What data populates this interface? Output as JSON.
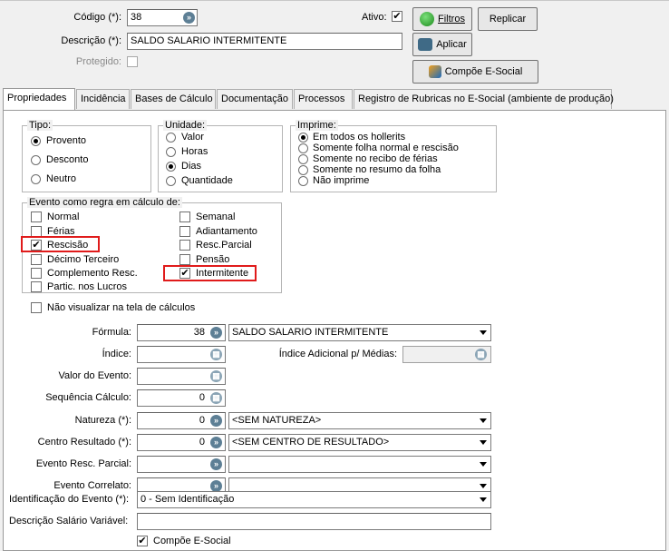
{
  "header": {
    "codigo_label": "Código (*):",
    "codigo_value": "38",
    "descricao_label": "Descrição (*):",
    "descricao_value": "SALDO SALARIO INTERMITENTE",
    "protegido_label": "Protegido:",
    "ativo_label": "Ativo:",
    "ativo_checked": "✔",
    "filtros_label": "Filtros",
    "aplicar_label": "Aplicar",
    "replicar_label": "Replicar",
    "compoe_label": "Compõe E-Social"
  },
  "tabs": [
    {
      "label": "Propriedades"
    },
    {
      "label": "Incidência"
    },
    {
      "label": "Bases de Cálculo"
    },
    {
      "label": "Documentação"
    },
    {
      "label": "Processos"
    },
    {
      "label": "Registro de Rubricas no E-Social (ambiente de produção)"
    }
  ],
  "tipo": {
    "title": "Tipo:",
    "options": [
      "Provento",
      "Desconto",
      "Neutro"
    ],
    "selected": "Provento"
  },
  "unidade": {
    "title": "Unidade:",
    "options": [
      "Valor",
      "Horas",
      "Dias",
      "Quantidade"
    ],
    "selected": "Dias"
  },
  "imprime": {
    "title": "Imprime:",
    "options": [
      "Em todos os hollerits",
      "Somente folha normal e rescisão",
      "Somente no recibo de férias",
      "Somente no resumo da folha",
      "Não imprime"
    ],
    "selected": "Em todos os hollerits"
  },
  "evento": {
    "title": "Evento como regra em cálculo de:",
    "left": [
      "Normal",
      "Férias",
      "Rescisão",
      "Décimo Terceiro",
      "Complemento Resc.",
      "Partic. nos Lucros"
    ],
    "right": [
      "Semanal",
      "Adiantamento",
      "Resc.Parcial",
      "Pensão",
      "Intermitente"
    ],
    "checked_mark": "✔"
  },
  "nao_visualizar_label": "Não visualizar na tela de cálculos",
  "form": {
    "formula_label": "Fórmula:",
    "formula_code": "38",
    "formula_desc": "SALDO SALARIO INTERMITENTE",
    "indice_label": "Índice:",
    "indice_adicional_label": "Índice Adicional p/ Médias:",
    "valor_evento_label": "Valor do Evento:",
    "sequencia_label": "Sequência Cálculo:",
    "sequencia_value": "0",
    "natureza_label": "Natureza (*):",
    "natureza_code": "0",
    "natureza_desc": "<SEM NATUREZA>",
    "centro_label": "Centro Resultado (*):",
    "centro_code": "0",
    "centro_desc": "<SEM CENTRO DE RESULTADO>",
    "evento_resc_label": "Evento Resc. Parcial:",
    "evento_correlato_label": "Evento Correlato:",
    "identificacao_label": "Identificação do Evento (*):",
    "identificacao_value": "0 - Sem Identificação",
    "descricao_salario_label": "Descrição Salário Variável:",
    "compoe_esocial_label": "Compõe E-Social"
  }
}
